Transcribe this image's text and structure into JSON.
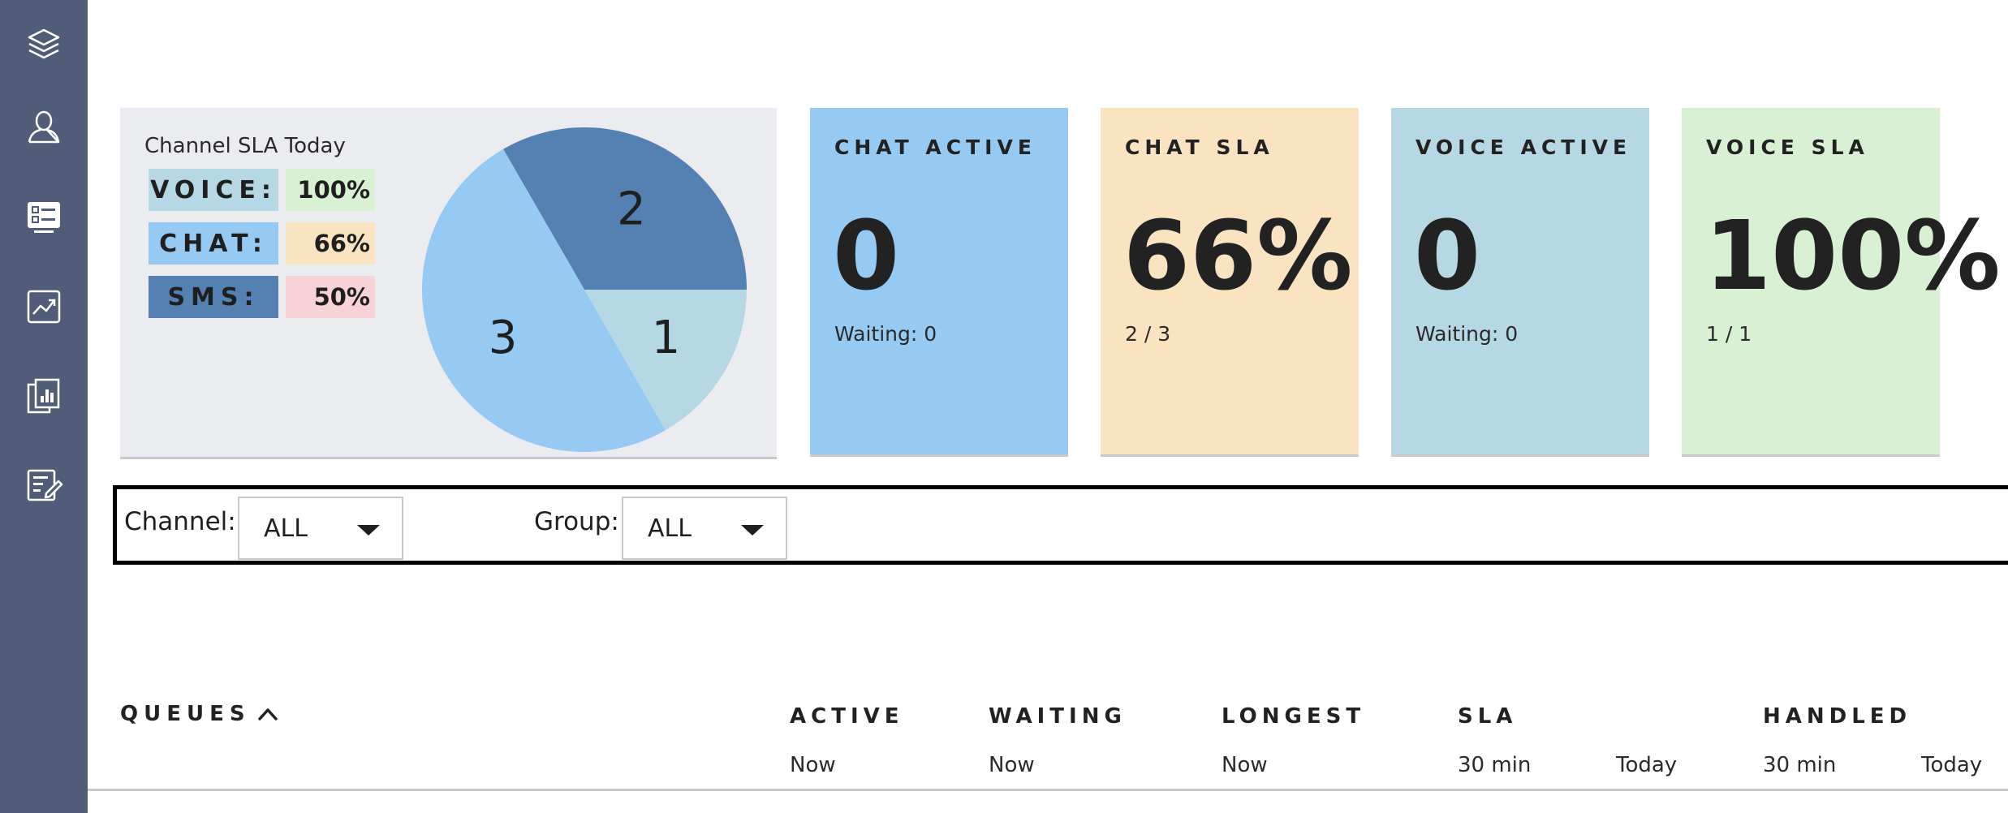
{
  "sidebar": {
    "items": [
      {
        "icon": "layers-icon",
        "name": "sidebar-item-layers"
      },
      {
        "icon": "user-icon",
        "name": "sidebar-item-agents"
      },
      {
        "icon": "card-list-icon",
        "name": "sidebar-item-dashboard"
      },
      {
        "icon": "trend-chart-icon",
        "name": "sidebar-item-analytics"
      },
      {
        "icon": "report-icon",
        "name": "sidebar-item-reports"
      },
      {
        "icon": "edit-form-icon",
        "name": "sidebar-item-forms"
      }
    ]
  },
  "sla_panel": {
    "title": "Channel SLA Today",
    "legend": [
      {
        "label": "VOICE:",
        "value": "100%",
        "label_color": "#b5d8e4",
        "value_color": "#d8f1d3"
      },
      {
        "label": "CHAT:",
        "value": "66%",
        "label_color": "#97caf3",
        "value_color": "#fae3c0"
      },
      {
        "label": "SMS:",
        "value": "50%",
        "label_color": "#5481b2",
        "value_color": "#f7d2d6"
      }
    ]
  },
  "chart_data": {
    "type": "pie",
    "slices": [
      {
        "label": "2",
        "value": 2,
        "color": "#5481b2"
      },
      {
        "label": "1",
        "value": 1,
        "color": "#b5d8e4"
      },
      {
        "label": "3",
        "value": 3,
        "color": "#97caf3"
      }
    ]
  },
  "stats": [
    {
      "title": "CHAT ACTIVE",
      "value": "0",
      "sub": "Waiting: 0",
      "color": "#97caf3"
    },
    {
      "title": "CHAT SLA",
      "value": "66%",
      "sub": "2 / 3",
      "color": "#fae3c0"
    },
    {
      "title": "VOICE ACTIVE",
      "value": "0",
      "sub": "Waiting: 0",
      "color": "#b5d8e4"
    },
    {
      "title": "VOICE SLA",
      "value": "100%",
      "sub": "1 / 1",
      "color": "#d8f1d3"
    }
  ],
  "filters": {
    "channel_label": "Channel:",
    "channel_value": "ALL",
    "group_label": "Group:",
    "group_value": "ALL"
  },
  "queues_table": {
    "title": "QUEUES",
    "columns": [
      {
        "header": "ACTIVE",
        "subs": [
          "Now"
        ]
      },
      {
        "header": "WAITING",
        "subs": [
          "Now"
        ]
      },
      {
        "header": "LONGEST",
        "subs": [
          "Now"
        ]
      },
      {
        "header": "SLA",
        "subs": [
          "30 min",
          "Today"
        ]
      },
      {
        "header": "HANDLED",
        "subs": [
          "30 min",
          "Today"
        ]
      }
    ]
  }
}
